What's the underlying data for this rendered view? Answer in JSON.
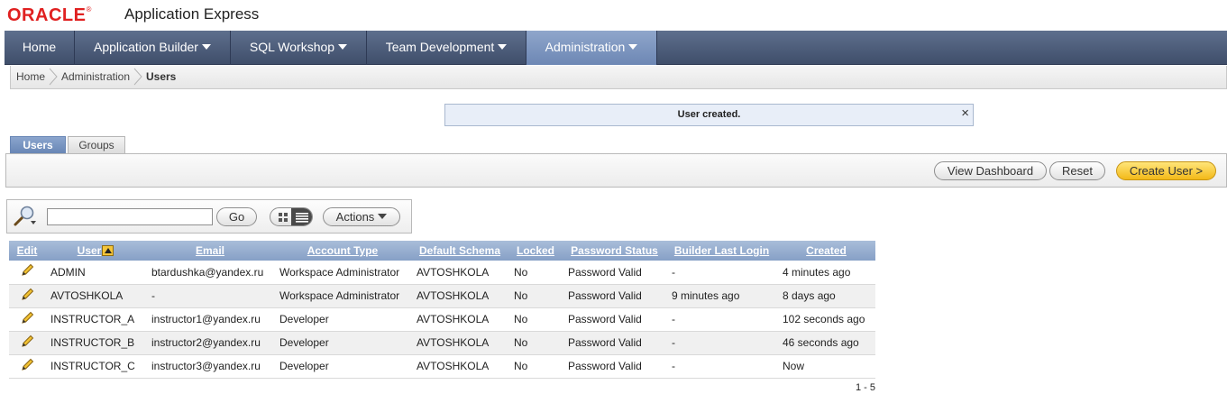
{
  "header": {
    "logo_text": "ORACLE",
    "logo_mark": "®",
    "app_title": "Application Express"
  },
  "nav": {
    "items": [
      {
        "label": "Home"
      },
      {
        "label": "Application Builder"
      },
      {
        "label": "SQL Workshop"
      },
      {
        "label": "Team Development"
      },
      {
        "label": "Administration"
      }
    ],
    "active_index": 4
  },
  "breadcrumb": {
    "items": [
      "Home",
      "Administration",
      "Users"
    ]
  },
  "notification": {
    "message": "User created.",
    "close_symbol": "×"
  },
  "tabs": [
    {
      "label": "Users",
      "active": true
    },
    {
      "label": "Groups",
      "active": false
    }
  ],
  "toolbar": {
    "view_dashboard_label": "View Dashboard",
    "reset_label": "Reset",
    "create_user_label": "Create User >"
  },
  "search": {
    "value": "",
    "go_label": "Go",
    "actions_label": "Actions"
  },
  "table": {
    "columns": [
      "Edit",
      "User",
      "Email",
      "Account Type",
      "Default Schema",
      "Locked",
      "Password Status",
      "Builder Last Login",
      "Created"
    ],
    "rows": [
      {
        "user": "ADMIN",
        "email": "btardushka@yandex.ru",
        "account_type": "Workspace Administrator",
        "schema": "AVTOSHKOLA",
        "locked": "No",
        "password_status": "Password Valid",
        "last_login": "-",
        "created": "4 minutes ago"
      },
      {
        "user": "AVTOSHKOLA",
        "email": "-",
        "account_type": "Workspace Administrator",
        "schema": "AVTOSHKOLA",
        "locked": "No",
        "password_status": "Password Valid",
        "last_login": "9 minutes ago",
        "created": "8 days ago"
      },
      {
        "user": "INSTRUCTOR_A",
        "email": "instructor1@yandex.ru",
        "account_type": "Developer",
        "schema": "AVTOSHKOLA",
        "locked": "No",
        "password_status": "Password Valid",
        "last_login": "-",
        "created": "102 seconds ago"
      },
      {
        "user": "INSTRUCTOR_B",
        "email": "instructor2@yandex.ru",
        "account_type": "Developer",
        "schema": "AVTOSHKOLA",
        "locked": "No",
        "password_status": "Password Valid",
        "last_login": "-",
        "created": "46 seconds ago"
      },
      {
        "user": "INSTRUCTOR_C",
        "email": "instructor3@yandex.ru",
        "account_type": "Developer",
        "schema": "AVTOSHKOLA",
        "locked": "No",
        "password_status": "Password Valid",
        "last_login": "-",
        "created": "Now"
      }
    ],
    "pagination": "1 - 5"
  },
  "icons": {
    "edit": "pencil-icon",
    "search": "magnifier-icon",
    "sort": "sort-ascending-icon",
    "view_toggle": [
      "grid-view-icon",
      "list-view-icon"
    ]
  },
  "colors": {
    "nav_bg": "#4a5a78",
    "nav_active": "#7b93bf",
    "header_row": "#94abcf",
    "logo_red": "#e02020",
    "primary_button": "#f5c232"
  }
}
